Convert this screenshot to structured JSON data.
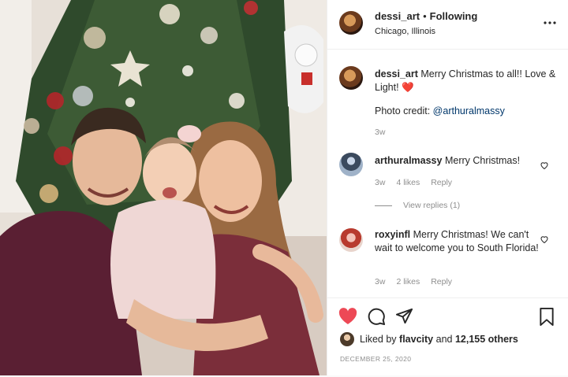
{
  "header": {
    "username": "dessi_art",
    "separator": "•",
    "follow_status": "Following",
    "location": "Chicago, Illinois",
    "more_icon": "more-options-icon"
  },
  "caption": {
    "username": "dessi_art",
    "text": "Merry Christmas to all!! Love & Light! ❤️",
    "credit_label": "Photo credit:",
    "credit_handle": "@arthuralmassy",
    "time": "3w"
  },
  "comments": [
    {
      "username": "arthuralmassy",
      "text": "Merry Christmas!",
      "time": "3w",
      "likes": "4 likes",
      "reply": "Reply",
      "view_replies": "View replies (1)"
    },
    {
      "username": "roxyinfl",
      "text": "Merry Christmas! We can't wait to welcome you to South Florida!",
      "time": "3w",
      "likes": "2 likes",
      "reply": "Reply"
    }
  ],
  "actions": {
    "like_icon": "heart-filled-icon",
    "comment_icon": "comment-icon",
    "share_icon": "share-icon",
    "save_icon": "bookmark-icon",
    "liked_by_prefix": "Liked by",
    "liked_by_user": "flavcity",
    "liked_by_and": "and",
    "liked_by_count": "12,155 others",
    "date": "DECEMBER 25, 2020"
  },
  "colors": {
    "like_red": "#ed4956",
    "link_blue": "#00376b",
    "muted_gray": "#8e8e8e"
  }
}
